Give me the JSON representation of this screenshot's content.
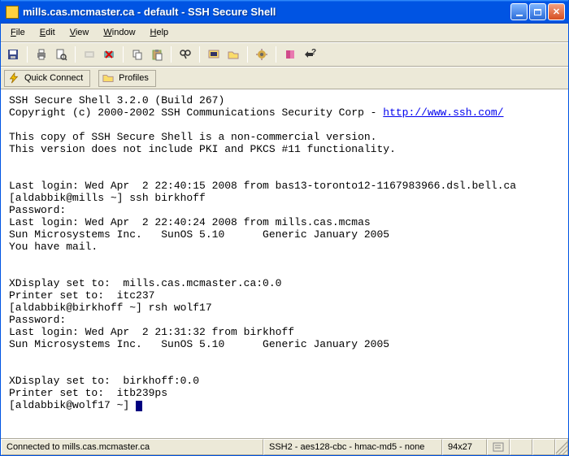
{
  "window": {
    "title": "mills.cas.mcmaster.ca - default - SSH Secure Shell"
  },
  "menu": {
    "file": "File",
    "edit": "Edit",
    "view": "View",
    "window": "Window",
    "help": "Help"
  },
  "connbar": {
    "quick_connect": "Quick Connect",
    "profiles": "Profiles"
  },
  "terminal": {
    "l1": "SSH Secure Shell 3.2.0 (Build 267)",
    "l2a": "Copyright (c) 2000-2002 SSH Communications Security Corp - ",
    "l2b": "http://www.ssh.com/",
    "l3": "",
    "l4": "This copy of SSH Secure Shell is a non-commercial version.",
    "l5": "This version does not include PKI and PKCS #11 functionality.",
    "l6": "",
    "l7": "",
    "l8": "Last login: Wed Apr  2 22:40:15 2008 from bas13-toronto12-1167983966.dsl.bell.ca",
    "l9": "[aldabbik@mills ~] ssh birkhoff",
    "l10": "Password:",
    "l11": "Last login: Wed Apr  2 22:40:24 2008 from mills.cas.mcmas",
    "l12": "Sun Microsystems Inc.   SunOS 5.10      Generic January 2005",
    "l13": "You have mail.",
    "l14": "",
    "l15": "",
    "l16": "XDisplay set to:  mills.cas.mcmaster.ca:0.0",
    "l17": "Printer set to:  itc237",
    "l18": "[aldabbik@birkhoff ~] rsh wolf17",
    "l19": "Password:",
    "l20": "Last login: Wed Apr  2 21:31:32 from birkhoff",
    "l21": "Sun Microsystems Inc.   SunOS 5.10      Generic January 2005",
    "l22": "",
    "l23": "",
    "l24": "XDisplay set to:  birkhoff:0.0",
    "l25": "Printer set to:  itb239ps",
    "l26": "[aldabbik@wolf17 ~] "
  },
  "status": {
    "connected": "Connected to mills.cas.mcmaster.ca",
    "cipher": "SSH2 - aes128-cbc - hmac-md5 - none",
    "size": "94x27"
  }
}
